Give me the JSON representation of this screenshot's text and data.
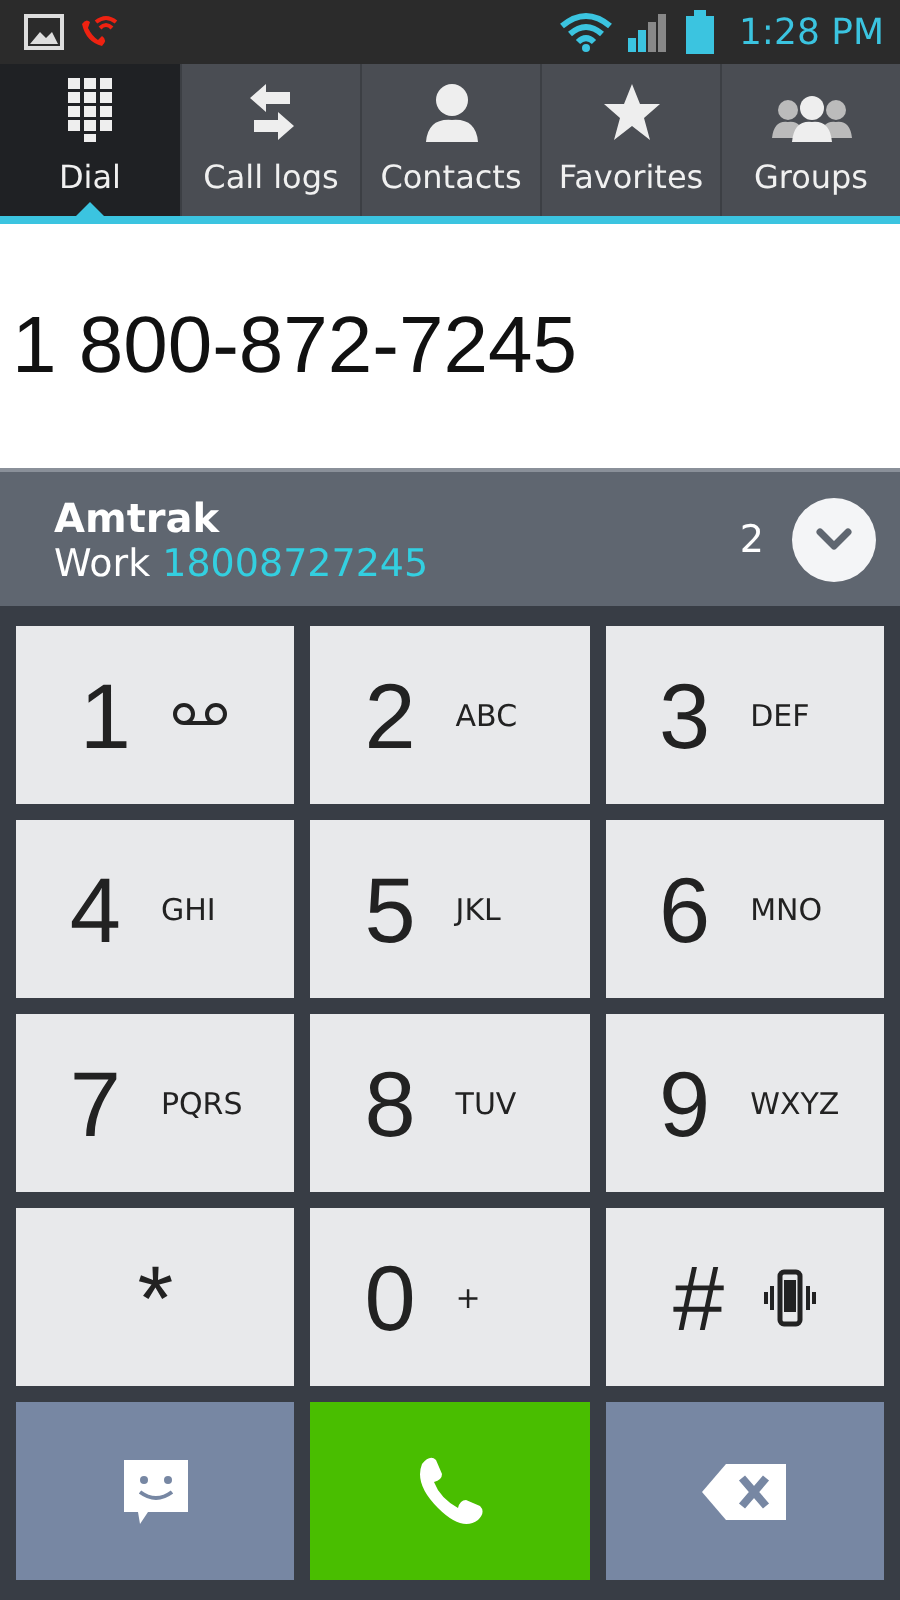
{
  "status_bar": {
    "time": "1:28 PM"
  },
  "tabs": [
    {
      "label": "Dial",
      "kind": "dialpad",
      "selected": true
    },
    {
      "label": "Call logs",
      "kind": "logs",
      "selected": false
    },
    {
      "label": "Contacts",
      "kind": "contacts",
      "selected": false
    },
    {
      "label": "Favorites",
      "kind": "favorites",
      "selected": false
    },
    {
      "label": "Groups",
      "kind": "groups",
      "selected": false
    }
  ],
  "dialed_number": "1 800-872-7245",
  "suggestion": {
    "name": "Amtrak",
    "type": "Work",
    "number": "18008727245",
    "count": "2"
  },
  "keys": [
    {
      "digit": "1",
      "kind": "voicemail"
    },
    {
      "digit": "2",
      "letters": "ABC",
      "kind": "letters"
    },
    {
      "digit": "3",
      "letters": "DEF",
      "kind": "letters"
    },
    {
      "digit": "4",
      "letters": "GHI",
      "kind": "letters"
    },
    {
      "digit": "5",
      "letters": "JKL",
      "kind": "letters"
    },
    {
      "digit": "6",
      "letters": "MNO",
      "kind": "letters"
    },
    {
      "digit": "7",
      "letters": "PQRS",
      "kind": "letters"
    },
    {
      "digit": "8",
      "letters": "TUV",
      "kind": "letters"
    },
    {
      "digit": "9",
      "letters": "WXYZ",
      "kind": "letters"
    },
    {
      "digit": "*",
      "kind": "plain"
    },
    {
      "digit": "0",
      "letters": "+",
      "kind": "letters"
    },
    {
      "digit": "#",
      "kind": "vibrate"
    }
  ],
  "actions": [
    {
      "kind": "message"
    },
    {
      "kind": "call"
    },
    {
      "kind": "backspace"
    }
  ]
}
